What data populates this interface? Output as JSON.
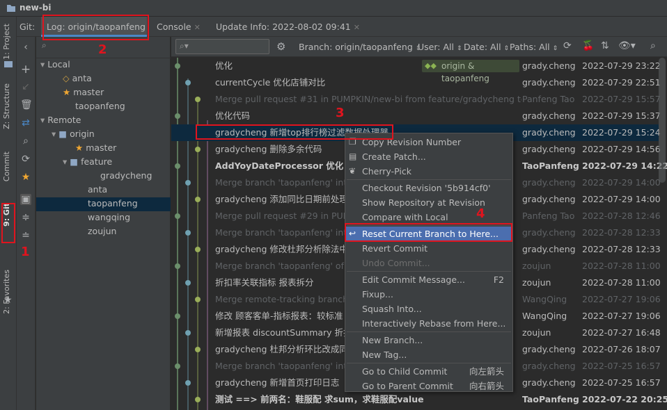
{
  "window": {
    "title": "new-bi"
  },
  "left_strip": {
    "project": "1: Project",
    "structure": "Z: Structure",
    "commit": "Commit",
    "git": "9: Git",
    "favorites": "2: Favorites"
  },
  "tabs": {
    "git_prefix": "Git:",
    "items": [
      {
        "label": "Log: origin/taopanfeng"
      },
      {
        "label": "Console"
      },
      {
        "label": "Update Info: 2022-08-02 09:41"
      }
    ]
  },
  "branches": {
    "local_label": "Local",
    "local": [
      "anta",
      "master",
      "taopanfeng"
    ],
    "remote_label": "Remote",
    "origin_label": "origin",
    "origin_master": "master",
    "feature_label": "feature",
    "feature_children": [
      "gradycheng"
    ],
    "origin_rest": [
      "anta",
      "taopanfeng",
      "wangqing",
      "zoujun"
    ]
  },
  "log_toolbar": {
    "branch": "Branch: origin/taopanfeng",
    "user": "User: All",
    "date": "Date: All",
    "paths": "Paths: All"
  },
  "commits": [
    {
      "msg": "优化",
      "author": "grady.cheng",
      "date": "2022-07-29 23:22",
      "style": "normal",
      "tag": "origin & taopanfeng"
    },
    {
      "msg": "currentCycle 优化店铺对比",
      "author": "grady.cheng",
      "date": "2022-07-29 22:51",
      "style": "normal"
    },
    {
      "msg": "Merge pull request #31 in PUMPKIN/new-bi from feature/gradycheng to ta",
      "author": "Panfeng Tao",
      "date": "2022-07-29 15:57",
      "style": "dim"
    },
    {
      "msg": "优化代码",
      "author": "grady.cheng",
      "date": "2022-07-29 15:37",
      "style": "normal"
    },
    {
      "msg": "gradycheng 新增top排行榜过滤数据处理器",
      "author": "grady.cheng",
      "date": "2022-07-29 15:24",
      "style": "selected"
    },
    {
      "msg": "gradycheng 删除多余代码",
      "author": "grady.cheng",
      "date": "2022-07-29 14:56",
      "style": "normal"
    },
    {
      "msg": "AddYoyDateProcessor 优化",
      "author": "TaoPanfeng",
      "date": "2022-07-29 14:22",
      "style": "bold"
    },
    {
      "msg": "Merge branch 'taopanfeng' into",
      "author": "grady.cheng",
      "date": "2022-07-29 14:00",
      "style": "dim"
    },
    {
      "msg": "gradycheng 添加同比日期前处理器",
      "author": "grady.cheng",
      "date": "2022-07-29 14:00",
      "style": "normal"
    },
    {
      "msg": "Merge pull request #29 in PUMP",
      "author": "Panfeng Tao",
      "date": "2022-07-28 12:46",
      "style": "dim"
    },
    {
      "msg": "Merge branch 'taopanfeng' into",
      "author": "grady.cheng",
      "date": "2022-07-28 12:33",
      "style": "dim"
    },
    {
      "msg": "gradycheng 修改杜邦分析除法中判",
      "author": "grady.cheng",
      "date": "2022-07-28 12:33",
      "style": "normal"
    },
    {
      "msg": "Merge branch 'taopanfeng' of s",
      "author": "zoujun",
      "date": "2022-07-28 11:00",
      "style": "dim"
    },
    {
      "msg": "折扣率关联指标 报表拆分",
      "author": "zoujun",
      "date": "2022-07-28 11:00",
      "style": "normal"
    },
    {
      "msg": "Merge remote-tracking branch",
      "author": "WangQing",
      "date": "2022-07-27 19:06",
      "style": "dim"
    },
    {
      "msg": "修改 顾客客单-指标报表：较标准",
      "author": "WangQing",
      "date": "2022-07-27 19:06",
      "style": "normal"
    },
    {
      "msg": "新增报表 discountSummary 折扣",
      "author": "zoujun",
      "date": "2022-07-27 16:48",
      "style": "normal"
    },
    {
      "msg": "gradycheng 杜邦分析环比改成同比",
      "author": "grady.cheng",
      "date": "2022-07-26 18:07",
      "style": "normal"
    },
    {
      "msg": "Merge branch 'taopanfeng' into",
      "author": "grady.cheng",
      "date": "2022-07-25 16:57",
      "style": "dim"
    },
    {
      "msg": "gradycheng 新增首页打印日志",
      "author": "grady.cheng",
      "date": "2022-07-25 16:57",
      "style": "normal"
    },
    {
      "msg": "测试 ==> 前两名：鞋服配 求sum，求鞋服配value",
      "author": "TaoPanfeng",
      "date": "2022-07-22 20:25",
      "style": "bold"
    }
  ],
  "context_menu": {
    "items": [
      {
        "label": "Copy Revision Number",
        "shortcut": "",
        "icon": "copy-icon"
      },
      {
        "label": "Create Patch...",
        "shortcut": "",
        "icon": "patch-icon"
      },
      {
        "label": "Cherry-Pick",
        "shortcut": "",
        "icon": "cherry-icon"
      },
      {
        "label": "Checkout Revision '5b914cf0'",
        "shortcut": ""
      },
      {
        "label": "Show Repository at Revision",
        "shortcut": ""
      },
      {
        "label": "Compare with Local",
        "shortcut": ""
      },
      {
        "label": "Reset Current Branch to Here...",
        "shortcut": "",
        "icon": "reset-icon",
        "highlight": true
      },
      {
        "label": "Revert Commit",
        "shortcut": ""
      },
      {
        "label": "Undo Commit...",
        "shortcut": "",
        "disabled": true
      },
      {
        "label": "Edit Commit Message...",
        "shortcut": "F2"
      },
      {
        "label": "Fixup...",
        "shortcut": ""
      },
      {
        "label": "Squash Into...",
        "shortcut": ""
      },
      {
        "label": "Interactively Rebase from Here...",
        "shortcut": ""
      },
      {
        "label": "New Branch...",
        "shortcut": ""
      },
      {
        "label": "New Tag...",
        "shortcut": ""
      },
      {
        "label": "Go to Child Commit",
        "shortcut": "向左箭头"
      },
      {
        "label": "Go to Parent Commit",
        "shortcut": "向右箭头"
      }
    ]
  },
  "annotations": {
    "n1": "1",
    "n2": "2",
    "n3": "3",
    "n4": "4"
  },
  "colors": {
    "red": "#e0141e",
    "selection": "#0d293e",
    "menu_highlight": "#4b6eaf",
    "tag_green": "#8bb452"
  }
}
